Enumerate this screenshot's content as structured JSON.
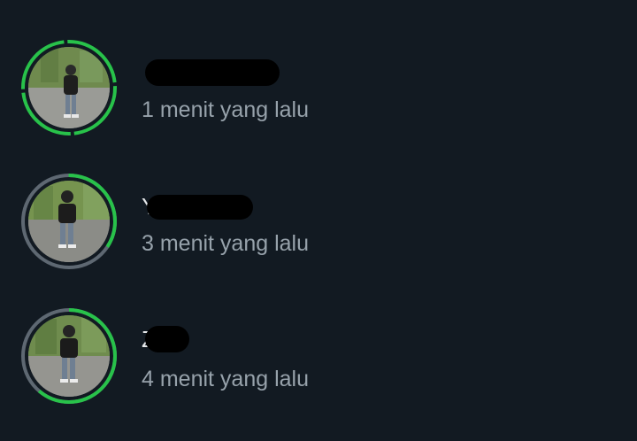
{
  "statuses": [
    {
      "name": "",
      "time": "1 menit yang lalu",
      "ring": "all-new",
      "ring_color": "#28c24a"
    },
    {
      "name": "Y           li",
      "time": "3 menit yang lalu",
      "ring": "partly-viewed",
      "ring_color": "#28c24a"
    },
    {
      "name": "Z",
      "time": "4 menit yang lalu",
      "ring": "partly-viewed",
      "ring_color": "#28c24a"
    }
  ],
  "colors": {
    "background": "#121a22",
    "new_update_ring": "#28c24a",
    "viewed_ring": "#5e6872",
    "timestamp_text": "#97a2ab",
    "redaction": "#000000"
  }
}
